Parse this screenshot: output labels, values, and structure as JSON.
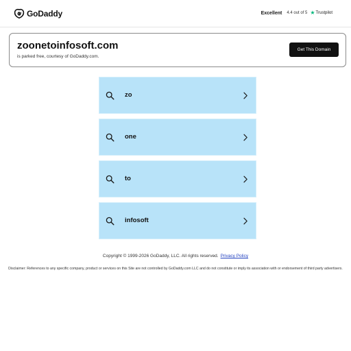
{
  "header": {
    "brand": "GoDaddy",
    "trustpilot": {
      "rating_word": "Excellent",
      "score_text": "4.4 out of 5",
      "brand": "Trustpilot",
      "star_color": "#00b67a"
    }
  },
  "domain_card": {
    "domain": "zoonetoinfosoft.com",
    "subtitle": "is parked free, courtesy of GoDaddy.com.",
    "cta_label": "Get This Domain"
  },
  "related_searches": [
    {
      "label": "zo",
      "icon": "search-icon",
      "action_icon": "chevron-right-icon"
    },
    {
      "label": "one",
      "icon": "search-icon",
      "action_icon": "chevron-right-icon"
    },
    {
      "label": "to",
      "icon": "search-icon",
      "action_icon": "chevron-right-icon"
    },
    {
      "label": "infosoft",
      "icon": "search-icon",
      "action_icon": "chevron-right-icon"
    }
  ],
  "footer": {
    "copyright": "Copyright © 1999-2026 GoDaddy, LLC. All rights reserved.",
    "privacy_link": "Privacy Policy",
    "disclaimer": "Disclaimer: References to any specific company, product or services on this Site are not controlled by GoDaddy.com LLC and do not constitute or imply its association with or endorsement of third party advertisers."
  },
  "colors": {
    "result_background": "#b8e3f9",
    "cta_background": "#111111",
    "link": "#1f3fbf"
  }
}
